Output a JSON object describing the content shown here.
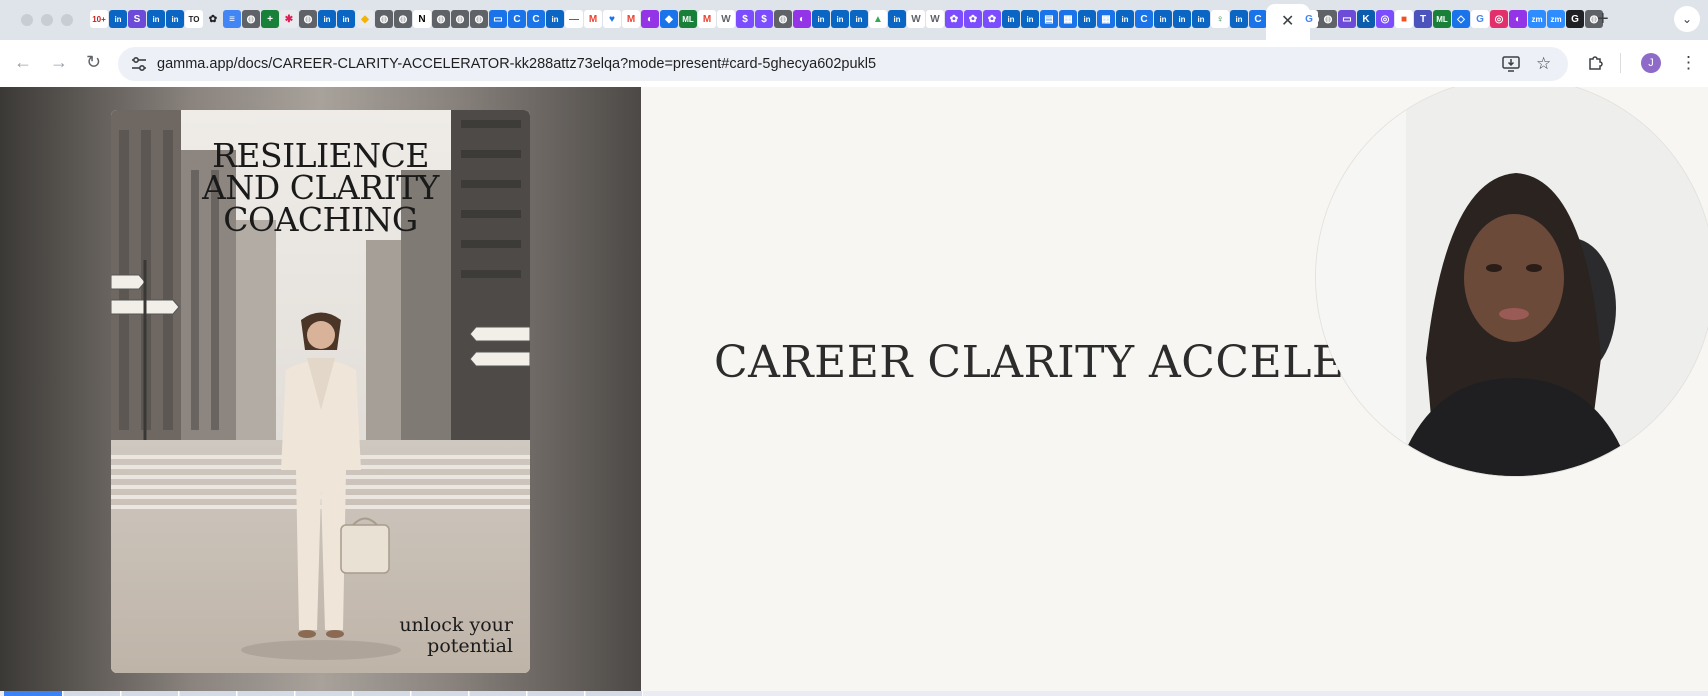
{
  "browser": {
    "url": "gamma.app/docs/CAREER-CLARITY-ACCELERATOR-kk288attz73elqa?mode=present#card-5ghecya602pukl5",
    "profile_initial": "J",
    "tab_favicons": [
      {
        "glyph": "10+",
        "bg": "#ffffff",
        "fg": "#c5221f"
      },
      {
        "glyph": "in",
        "bg": "#0a66c2",
        "fg": "#ffffff"
      },
      {
        "glyph": "S",
        "bg": "#6c4bd8",
        "fg": "#ffffff"
      },
      {
        "glyph": "in",
        "bg": "#0a66c2",
        "fg": "#ffffff"
      },
      {
        "glyph": "in",
        "bg": "#0a66c2",
        "fg": "#ffffff"
      },
      {
        "glyph": "TO",
        "bg": "#ffffff",
        "fg": "#202124"
      },
      {
        "glyph": "✿",
        "bg": "#dfe3ea",
        "fg": "#202124"
      },
      {
        "glyph": "≡",
        "bg": "#4285f4",
        "fg": "#ffffff"
      },
      {
        "glyph": "◍",
        "bg": "#5f6368",
        "fg": "#ffffff"
      },
      {
        "glyph": "+",
        "bg": "#188038",
        "fg": "#ffffff"
      },
      {
        "glyph": "✱",
        "bg": "#e8eaed",
        "fg": "#e01e5a"
      },
      {
        "glyph": "◍",
        "bg": "#5f6368",
        "fg": "#ffffff"
      },
      {
        "glyph": "in",
        "bg": "#0a66c2",
        "fg": "#ffffff"
      },
      {
        "glyph": "in",
        "bg": "#0a66c2",
        "fg": "#ffffff"
      },
      {
        "glyph": "◆",
        "bg": "#e8eaed",
        "fg": "#f4b400"
      },
      {
        "glyph": "◍",
        "bg": "#5f6368",
        "fg": "#ffffff"
      },
      {
        "glyph": "◍",
        "bg": "#5f6368",
        "fg": "#ffffff"
      },
      {
        "glyph": "N",
        "bg": "#ffffff",
        "fg": "#000000"
      },
      {
        "glyph": "◍",
        "bg": "#5f6368",
        "fg": "#ffffff"
      },
      {
        "glyph": "◍",
        "bg": "#5f6368",
        "fg": "#ffffff"
      },
      {
        "glyph": "◍",
        "bg": "#5f6368",
        "fg": "#ffffff"
      },
      {
        "glyph": "▭",
        "bg": "#1a73e8",
        "fg": "#ffffff"
      },
      {
        "glyph": "C",
        "bg": "#1a73e8",
        "fg": "#ffffff"
      },
      {
        "glyph": "C",
        "bg": "#1a73e8",
        "fg": "#ffffff"
      },
      {
        "glyph": "in",
        "bg": "#0a66c2",
        "fg": "#ffffff"
      },
      {
        "glyph": "—",
        "bg": "#ffffff",
        "fg": "#5f6368"
      },
      {
        "glyph": "M",
        "bg": "#ffffff",
        "fg": "#ea4335"
      },
      {
        "glyph": "♥",
        "bg": "#ffffff",
        "fg": "#1a73e8"
      },
      {
        "glyph": "M",
        "bg": "#ffffff",
        "fg": "#ea4335"
      },
      {
        "glyph": "◐",
        "bg": "#9334e6",
        "fg": "#ffffff"
      },
      {
        "glyph": "◆",
        "bg": "#1a73e8",
        "fg": "#ffffff"
      },
      {
        "glyph": "ML",
        "bg": "#188038",
        "fg": "#ffffff"
      },
      {
        "glyph": "M",
        "bg": "#ffffff",
        "fg": "#ea4335"
      },
      {
        "glyph": "W",
        "bg": "#ffffff",
        "fg": "#5f6368"
      },
      {
        "glyph": "$",
        "bg": "#7c4dff",
        "fg": "#ffffff"
      },
      {
        "glyph": "$",
        "bg": "#7c4dff",
        "fg": "#ffffff"
      },
      {
        "glyph": "◍",
        "bg": "#5f6368",
        "fg": "#ffffff"
      },
      {
        "glyph": "◐",
        "bg": "#9334e6",
        "fg": "#ffffff"
      },
      {
        "glyph": "in",
        "bg": "#0a66c2",
        "fg": "#ffffff"
      },
      {
        "glyph": "in",
        "bg": "#0a66c2",
        "fg": "#ffffff"
      },
      {
        "glyph": "in",
        "bg": "#0a66c2",
        "fg": "#ffffff"
      },
      {
        "glyph": "▲",
        "bg": "#ffffff",
        "fg": "#34a853"
      },
      {
        "glyph": "in",
        "bg": "#0a66c2",
        "fg": "#ffffff"
      },
      {
        "glyph": "W",
        "bg": "#ffffff",
        "fg": "#5f6368"
      },
      {
        "glyph": "W",
        "bg": "#ffffff",
        "fg": "#5f6368"
      },
      {
        "glyph": "✿",
        "bg": "#7c4dff",
        "fg": "#ffffff"
      },
      {
        "glyph": "✿",
        "bg": "#7c4dff",
        "fg": "#ffffff"
      },
      {
        "glyph": "✿",
        "bg": "#7c4dff",
        "fg": "#ffffff"
      },
      {
        "glyph": "in",
        "bg": "#0a66c2",
        "fg": "#ffffff"
      },
      {
        "glyph": "in",
        "bg": "#0a66c2",
        "fg": "#ffffff"
      },
      {
        "glyph": "▤",
        "bg": "#1a73e8",
        "fg": "#ffffff"
      },
      {
        "glyph": "▦",
        "bg": "#1a73e8",
        "fg": "#ffffff"
      },
      {
        "glyph": "in",
        "bg": "#0a66c2",
        "fg": "#ffffff"
      },
      {
        "glyph": "▦",
        "bg": "#1a73e8",
        "fg": "#ffffff"
      },
      {
        "glyph": "in",
        "bg": "#0a66c2",
        "fg": "#ffffff"
      },
      {
        "glyph": "C",
        "bg": "#1a73e8",
        "fg": "#ffffff"
      },
      {
        "glyph": "in",
        "bg": "#0a66c2",
        "fg": "#ffffff"
      },
      {
        "glyph": "in",
        "bg": "#0a66c2",
        "fg": "#ffffff"
      },
      {
        "glyph": "in",
        "bg": "#0a66c2",
        "fg": "#ffffff"
      },
      {
        "glyph": "♀",
        "bg": "#ffffff",
        "fg": "#188038"
      },
      {
        "glyph": "in",
        "bg": "#0a66c2",
        "fg": "#ffffff"
      },
      {
        "glyph": "C",
        "bg": "#1a73e8",
        "fg": "#ffffff"
      },
      {
        "glyph": "K",
        "bg": "#0b5cad",
        "fg": "#ffffff"
      },
      {
        "glyph": "K",
        "bg": "#0e2033",
        "fg": "#ffffff"
      },
      {
        "glyph": "◍",
        "bg": "#5f6368",
        "fg": "#ffffff"
      }
    ],
    "tab_favicons_after": [
      {
        "glyph": "G",
        "bg": "#ffffff",
        "fg": "#4285f4"
      },
      {
        "glyph": "◍",
        "bg": "#5f6368",
        "fg": "#ffffff"
      },
      {
        "glyph": "▭",
        "bg": "#6c4bd8",
        "fg": "#ffffff"
      },
      {
        "glyph": "K",
        "bg": "#0b5cad",
        "fg": "#ffffff"
      },
      {
        "glyph": "◎",
        "bg": "#7c4dff",
        "fg": "#ffffff"
      },
      {
        "glyph": "■",
        "bg": "#ffffff",
        "fg": "#f25022"
      },
      {
        "glyph": "T",
        "bg": "#4b53bc",
        "fg": "#ffffff"
      },
      {
        "glyph": "ML",
        "bg": "#188038",
        "fg": "#ffffff"
      },
      {
        "glyph": "◇",
        "bg": "#1a73e8",
        "fg": "#ffffff"
      },
      {
        "glyph": "G",
        "bg": "#ffffff",
        "fg": "#4285f4"
      },
      {
        "glyph": "◎",
        "bg": "#e1306c",
        "fg": "#ffffff"
      },
      {
        "glyph": "◐",
        "bg": "#9334e6",
        "fg": "#ffffff"
      },
      {
        "glyph": "zm",
        "bg": "#2d8cff",
        "fg": "#ffffff"
      },
      {
        "glyph": "zm",
        "bg": "#2d8cff",
        "fg": "#ffffff"
      },
      {
        "glyph": "G",
        "bg": "#202124",
        "fg": "#ffffff"
      },
      {
        "glyph": "◍",
        "bg": "#5f6368",
        "fg": "#ffffff"
      }
    ]
  },
  "poster": {
    "title_line1": "RESILIENCE",
    "title_line2": "AND CLARITY",
    "title_line3": "COACHING",
    "tagline_line1": "unlock your",
    "tagline_line2": "potential"
  },
  "slide": {
    "title": "CAREER CLARITY ACCELERAT"
  }
}
